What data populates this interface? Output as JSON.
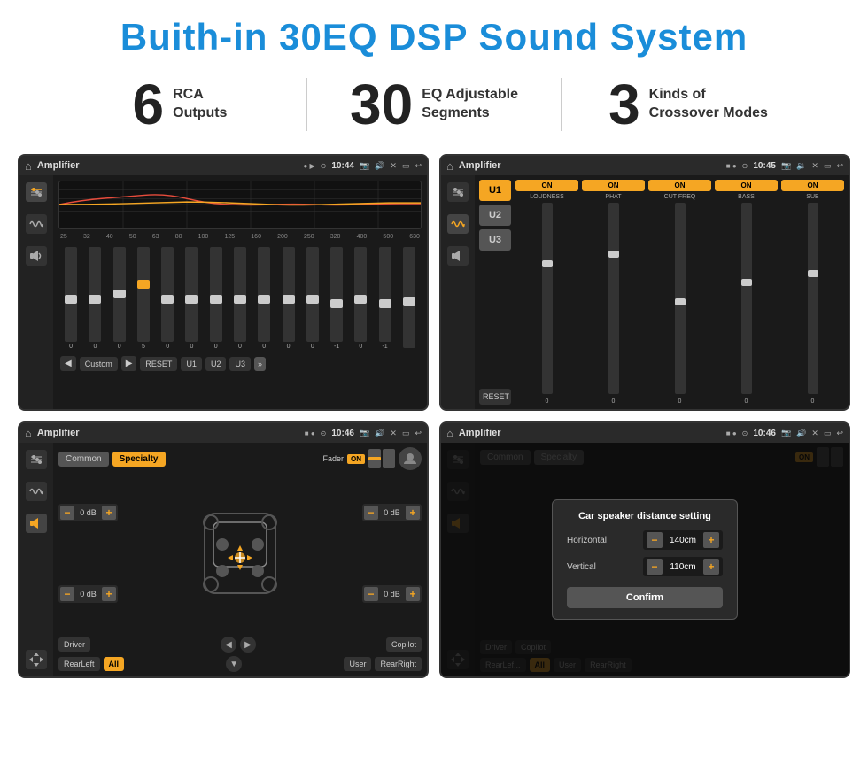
{
  "header": {
    "title": "Buith-in 30EQ DSP Sound System"
  },
  "stats": [
    {
      "number": "6",
      "label": "RCA\nOutputs"
    },
    {
      "number": "30",
      "label": "EQ Adjustable\nSegments"
    },
    {
      "number": "3",
      "label": "Kinds of\nCrossover Modes"
    }
  ],
  "screens": [
    {
      "id": "eq-screen",
      "statusBar": {
        "title": "Amplifier",
        "time": "10:44"
      },
      "type": "eq"
    },
    {
      "id": "crossover-screen",
      "statusBar": {
        "title": "Amplifier",
        "time": "10:45"
      },
      "type": "crossover"
    },
    {
      "id": "specialty-screen",
      "statusBar": {
        "title": "Amplifier",
        "time": "10:46"
      },
      "type": "specialty"
    },
    {
      "id": "dialog-screen",
      "statusBar": {
        "title": "Amplifier",
        "time": "10:46"
      },
      "type": "dialog"
    }
  ],
  "eq": {
    "frequencies": [
      "25",
      "32",
      "40",
      "50",
      "63",
      "80",
      "100",
      "125",
      "160",
      "200",
      "250",
      "320",
      "400",
      "500",
      "630"
    ],
    "values": [
      "0",
      "0",
      "0",
      "5",
      "0",
      "0",
      "0",
      "0",
      "0",
      "0",
      "0",
      "-1",
      "0",
      "-1",
      ""
    ],
    "presets": [
      "Custom",
      "RESET",
      "U1",
      "U2",
      "U3"
    ]
  },
  "crossover": {
    "presets": [
      "U1",
      "U2",
      "U3"
    ],
    "channels": [
      {
        "name": "LOUDNESS",
        "on": true
      },
      {
        "name": "PHAT",
        "on": true
      },
      {
        "name": "CUT FREQ",
        "on": true
      },
      {
        "name": "BASS",
        "on": true
      },
      {
        "name": "SUB",
        "on": true
      }
    ]
  },
  "specialty": {
    "tabs": [
      "Common",
      "Specialty"
    ],
    "fader": {
      "label": "Fader",
      "on": true
    },
    "dbValues": [
      "0 dB",
      "0 dB",
      "0 dB",
      "0 dB"
    ],
    "buttons": [
      "Driver",
      "Copilot",
      "RearLeft",
      "All",
      "User",
      "RearRight"
    ]
  },
  "dialog": {
    "title": "Car speaker distance setting",
    "horizontal": {
      "label": "Horizontal",
      "value": "140cm"
    },
    "vertical": {
      "label": "Vertical",
      "value": "110cm"
    },
    "confirmLabel": "Confirm"
  }
}
